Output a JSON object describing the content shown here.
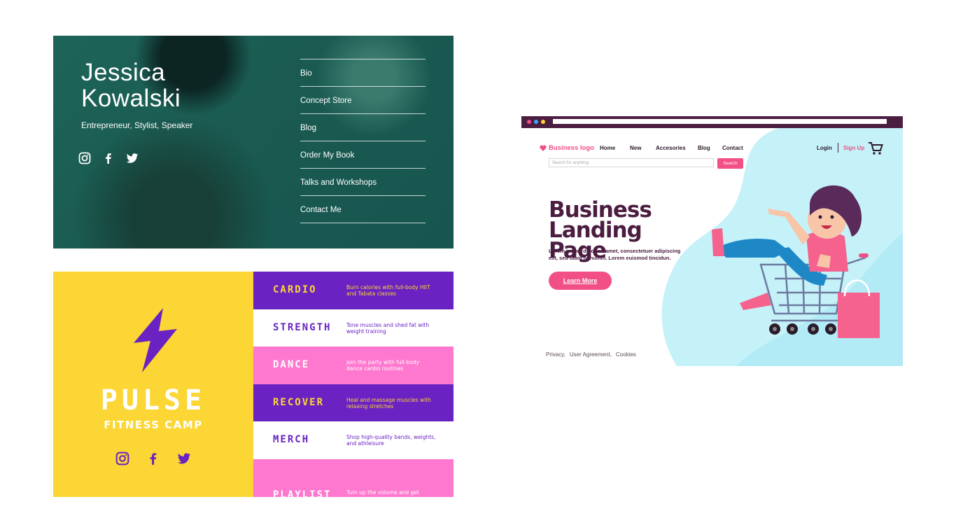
{
  "jessica": {
    "name_line1": "Jessica",
    "name_line2": "Kowalski",
    "subtitle": "Entrepreneur, Stylist, Speaker",
    "social": [
      "instagram-icon",
      "facebook-icon",
      "twitter-icon"
    ],
    "menu": [
      "Bio",
      "Concept Store",
      "Blog",
      "Order My Book",
      "Talks and Workshops",
      "Contact Me"
    ],
    "colors": {
      "background": "#1a5a51",
      "text": "#ffffff"
    }
  },
  "pulse": {
    "name": "PULSE",
    "tagline": "FITNESS CAMP",
    "social": [
      "instagram-icon",
      "facebook-icon",
      "twitter-icon"
    ],
    "rows": [
      {
        "title": "CARDIO",
        "desc": "Burn calories with full-body HIIT and Tabata classes",
        "bg": "#6a22c3",
        "title_color": "#fcd634",
        "desc_color": "#fcd634"
      },
      {
        "title": "STRENGTH",
        "desc": "Tone muscles and shed fat with weight training",
        "bg": "#ffffff",
        "title_color": "#6a22c3",
        "desc_color": "#6a22c3"
      },
      {
        "title": "DANCE",
        "desc": "Join the party with full-body dance cardio routines",
        "bg": "#ff78cf",
        "title_color": "#ffffff",
        "desc_color": "#ffffff"
      },
      {
        "title": "RECOVER",
        "desc": "Heal and massage muscles with relaxing stretches",
        "bg": "#6a22c3",
        "title_color": "#fcd634",
        "desc_color": "#fcd634"
      },
      {
        "title": "MERCH",
        "desc": "Shop high-quality bands, weights, and athleisure",
        "bg": "#ffffff",
        "title_color": "#6a22c3",
        "desc_color": "#6a22c3"
      },
      {
        "title": "PLAYLIST",
        "desc": "Turn up the volume and get",
        "bg": "#ff78cf",
        "title_color": "#ffffff",
        "desc_color": "#ffffff"
      }
    ],
    "colors": {
      "yellow": "#fcd634",
      "purple": "#6a22c3",
      "pink": "#ff78cf"
    }
  },
  "business": {
    "logo": "Business logo",
    "nav": [
      "Home",
      "New",
      "Accesories",
      "Blog",
      "Contact"
    ],
    "login": "Login",
    "signup": "Sign Up",
    "search_placeholder": "Search for anything",
    "search_button": "Search",
    "title_line1": "Business",
    "title_line2": "Landing Page",
    "description": "Lorem ipsum dolor sit amet, consectetuer adipiscing elit, sed diam nonumm. Lorem euismod tincidun.",
    "cta": "Learn More",
    "footer": [
      "Privacy,",
      "User Agreement,",
      "Cookies"
    ],
    "colors": {
      "accent": "#f14f85",
      "dark": "#4b1d40",
      "blob": "#b6eef7"
    }
  }
}
